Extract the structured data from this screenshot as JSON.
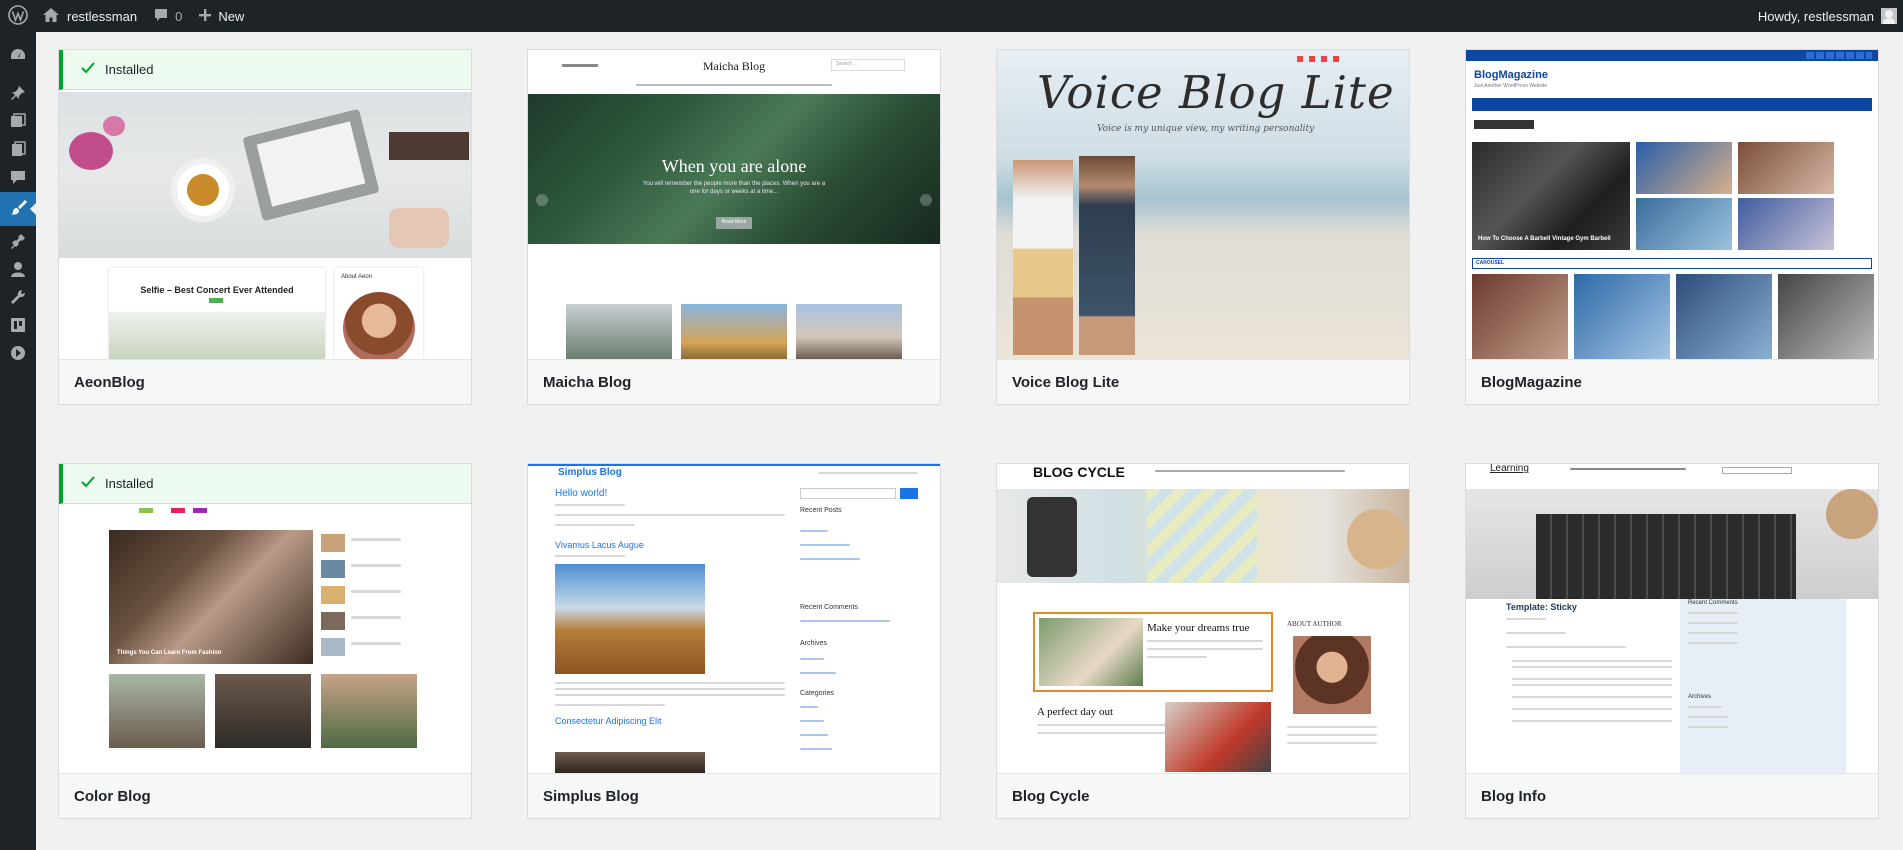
{
  "adminbar": {
    "site_name": "restlessman",
    "comments_count": "0",
    "new_label": "New",
    "howdy": "Howdy, restlessman"
  },
  "icons": {
    "wp_logo": "wordpress-icon",
    "home": "home-icon",
    "comments": "comment-icon",
    "new": "plus-icon",
    "avatar": "avatar-icon"
  },
  "sidebar": {
    "items": [
      "dashboard",
      "posts",
      "media",
      "pages",
      "comments",
      "appearance",
      "plugins",
      "users",
      "tools",
      "settings",
      "collapse"
    ],
    "current": "appearance"
  },
  "installed_label": "Installed",
  "themes": [
    {
      "name": "AeonBlog",
      "installed": true,
      "preview": {
        "post_title": "Selfie – Best Concert Ever Attended",
        "widget_title": "About Aeon"
      }
    },
    {
      "name": "Maicha Blog",
      "installed": false,
      "preview": {
        "site_title": "Maicha Blog",
        "search": "Search ...",
        "hero_title": "When you are alone",
        "hero_text": "You will remember the people more than the places. When you are a one for days or weeks at a time...",
        "button": "Read More"
      }
    },
    {
      "name": "Voice Blog Lite",
      "installed": false,
      "preview": {
        "site_title": "Voice Blog Lite",
        "tagline": "Voice is my unique view, my writing personality"
      }
    },
    {
      "name": "BlogMagazine",
      "installed": false,
      "preview": {
        "site_title": "BlogMagazine",
        "tagline": "Just Another WordPress Website",
        "hero_caption": "How To Choose A Barbell Vintage Gym Barbell",
        "carousel": "CAROUSEL"
      }
    },
    {
      "name": "Color Blog",
      "installed": true,
      "preview": {
        "hero_caption": "Things You Can Learn From Fashion"
      }
    },
    {
      "name": "Simplus Blog",
      "installed": false,
      "preview": {
        "site_title": "Simplus Blog",
        "post1": "Hello world!",
        "post2": "Vivamus Lacus Augue",
        "post3": "Consectetur Adipiscing Elit",
        "w1": "Recent Posts",
        "w2": "Recent Comments",
        "w3": "Archives",
        "w4": "Categories"
      }
    },
    {
      "name": "Blog Cycle",
      "installed": false,
      "preview": {
        "site_title": "BLOG CYCLE",
        "post1": "Make your dreams true",
        "post2": "A perfect day out",
        "widget": "ABOUT AUTHOR"
      }
    },
    {
      "name": "Blog Info",
      "installed": false,
      "preview": {
        "site_title": "Learning",
        "post_title": "Template: Sticky",
        "w1": "Recent Comments",
        "w2": "Archives"
      }
    }
  ],
  "colors": {
    "adminbar_bg": "#1d2327",
    "menu_current": "#2271b1",
    "installed_accent": "#00a32a",
    "page_bg": "#f1f1f1"
  }
}
